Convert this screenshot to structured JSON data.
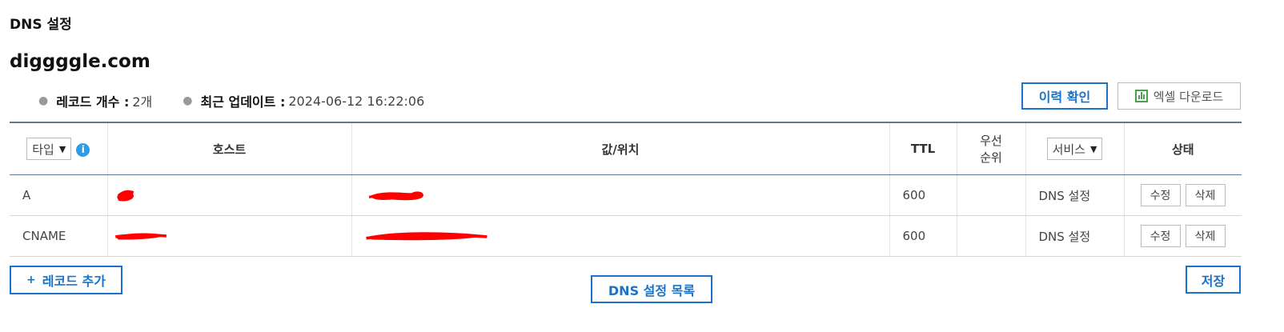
{
  "page": {
    "section_title": "DNS 설정",
    "domain": "diggggle.com"
  },
  "summary": {
    "record_count_label": "레코드 개수 :",
    "record_count_value": "2개",
    "last_update_label": "최근 업데이트 :",
    "last_update_value": "2024-06-12 16:22:06"
  },
  "toolbar": {
    "history_label": "이력 확인",
    "excel_label": "엑셀 다운로드",
    "excel_icon": "excel-chart-icon"
  },
  "table": {
    "headers": {
      "type": "타입",
      "host": "호스트",
      "value": "값/위치",
      "ttl": "TTL",
      "priority_line1": "우선",
      "priority_line2": "순위",
      "service": "서비스",
      "status": "상태"
    },
    "rows": [
      {
        "type": "A",
        "ttl": "600",
        "priority": "",
        "service": "DNS 설정",
        "edit": "수정",
        "delete": "삭제"
      },
      {
        "type": "CNAME",
        "ttl": "600",
        "priority": "",
        "service": "DNS 설정",
        "edit": "수정",
        "delete": "삭제"
      }
    ]
  },
  "footer": {
    "add_label": "레코드 추가",
    "list_label": "DNS 설정 목록",
    "save_label": "저장"
  },
  "colors": {
    "accent": "#1a73c8",
    "redaction": "#ff0000",
    "header_rule": "#5a7a9a"
  }
}
